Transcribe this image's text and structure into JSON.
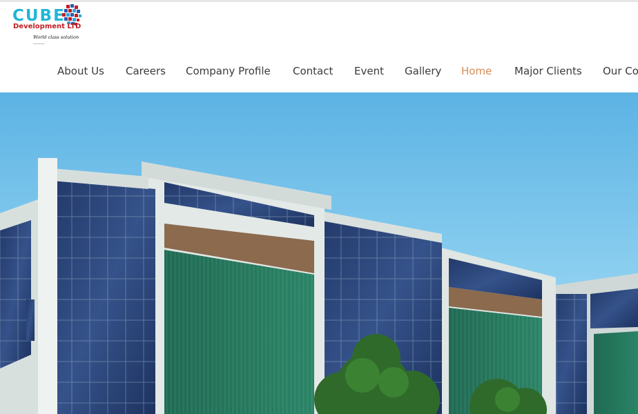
{
  "brand": {
    "name": "CUBE",
    "subtitle": "Development LTD",
    "tagline": "World class solution ........"
  },
  "nav": {
    "items": [
      {
        "label": "About Us",
        "active": false
      },
      {
        "label": "Careers",
        "active": false
      },
      {
        "label": "Company Profile",
        "active": false
      },
      {
        "label": "Contact",
        "active": false
      },
      {
        "label": "Event",
        "active": false
      },
      {
        "label": "Gallery",
        "active": false
      },
      {
        "label": "Home",
        "active": true
      },
      {
        "label": "Major Clients",
        "active": false
      },
      {
        "label": "Our Co",
        "active": false
      }
    ]
  },
  "colors": {
    "accent": "#d98b55",
    "nav_text": "#3b3b3b",
    "logo_cyan": "#20b7d5",
    "logo_red": "#c31d24",
    "sky": "#6fc0ea"
  },
  "hero": {
    "image": "office-building-photo"
  }
}
